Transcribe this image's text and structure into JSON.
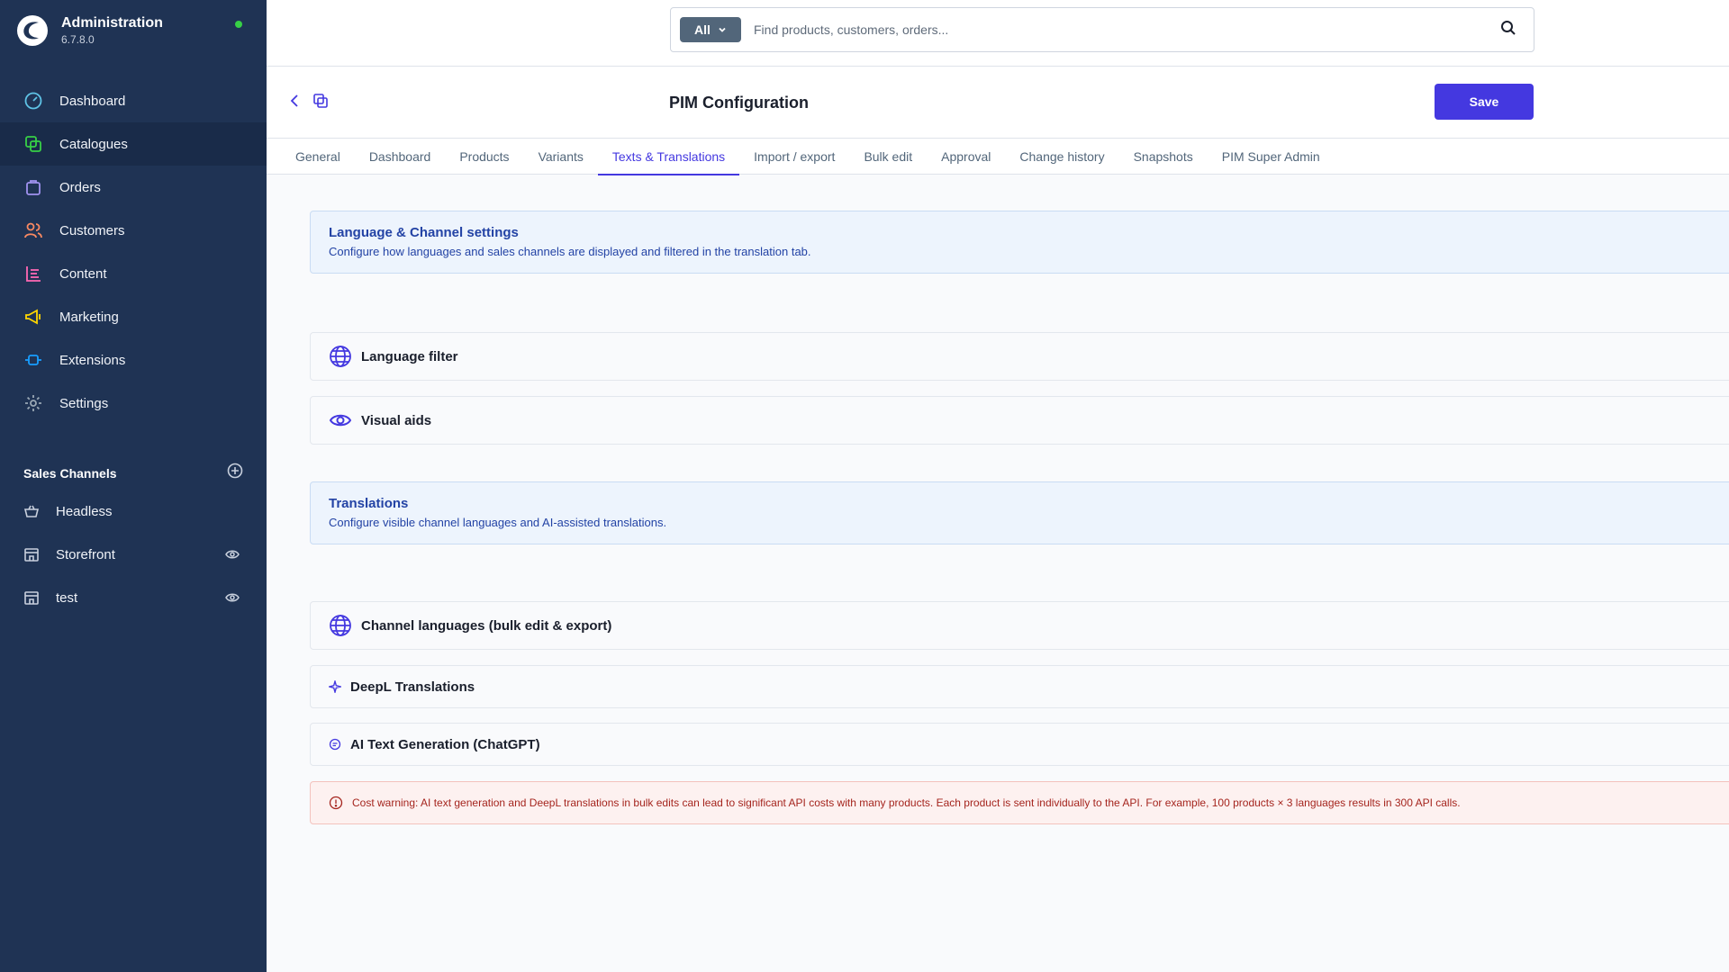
{
  "app": {
    "title": "Administration",
    "version": "6.7.8.0",
    "status_color": "#37d046"
  },
  "sidebar": {
    "items": [
      {
        "label": "Dashboard",
        "icon": "dashboard-gauge-icon",
        "color": "#5fc3e6"
      },
      {
        "label": "Catalogues",
        "icon": "catalogue-icon",
        "color": "#37d046",
        "active": true
      },
      {
        "label": "Orders",
        "icon": "shopping-bag-icon",
        "color": "#a092f0"
      },
      {
        "label": "Customers",
        "icon": "users-icon",
        "color": "#f88962"
      },
      {
        "label": "Content",
        "icon": "content-list-icon",
        "color": "#ff68b4"
      },
      {
        "label": "Marketing",
        "icon": "megaphone-icon",
        "color": "#ffd700"
      },
      {
        "label": "Extensions",
        "icon": "plug-icon",
        "color": "#189eff"
      },
      {
        "label": "Settings",
        "icon": "gear-icon",
        "color": "#9aa8b5"
      }
    ],
    "sales_channels": {
      "title": "Sales Channels",
      "items": [
        {
          "label": "Headless",
          "icon": "basket-icon"
        },
        {
          "label": "Storefront",
          "icon": "storefront-icon"
        },
        {
          "label": "test",
          "icon": "storefront-icon"
        }
      ]
    }
  },
  "search": {
    "type_label": "All",
    "placeholder": "Find products, customers, orders..."
  },
  "page": {
    "title": "PIM Configuration",
    "save_label": "Save",
    "accent": "#4438e0"
  },
  "tabs": [
    {
      "label": "General"
    },
    {
      "label": "Dashboard"
    },
    {
      "label": "Products"
    },
    {
      "label": "Variants"
    },
    {
      "label": "Texts & Translations",
      "active": true
    },
    {
      "label": "Import / export"
    },
    {
      "label": "Bulk edit"
    },
    {
      "label": "Approval"
    },
    {
      "label": "Change history"
    },
    {
      "label": "Snapshots"
    },
    {
      "label": "PIM Super Admin"
    }
  ],
  "sections": {
    "language_channel": {
      "title": "Language & Channel settings",
      "text": "Configure how languages and sales channels are displayed and filtered in the translation tab."
    },
    "language_filter": {
      "title": "Language filter",
      "icon": "globe-icon"
    },
    "visual_aids": {
      "title": "Visual aids",
      "icon": "eye-icon"
    },
    "translations": {
      "title": "Translations",
      "text": "Configure visible channel languages and AI-assisted translations."
    },
    "channel_languages": {
      "title": "Channel languages (bulk edit & export)",
      "icon": "globe-icon"
    },
    "deepl": {
      "title": "DeepL Translations",
      "icon": "sparkle-icon"
    },
    "ai_text": {
      "title": "AI Text Generation (ChatGPT)",
      "icon": "chat-icon"
    },
    "warning": {
      "text": "Cost warning: AI text generation and DeepL translations in bulk edits can lead to significant API costs with many products. Each product is sent individually to the API. For example, 100 products × 3 languages results in 300 API calls."
    }
  }
}
